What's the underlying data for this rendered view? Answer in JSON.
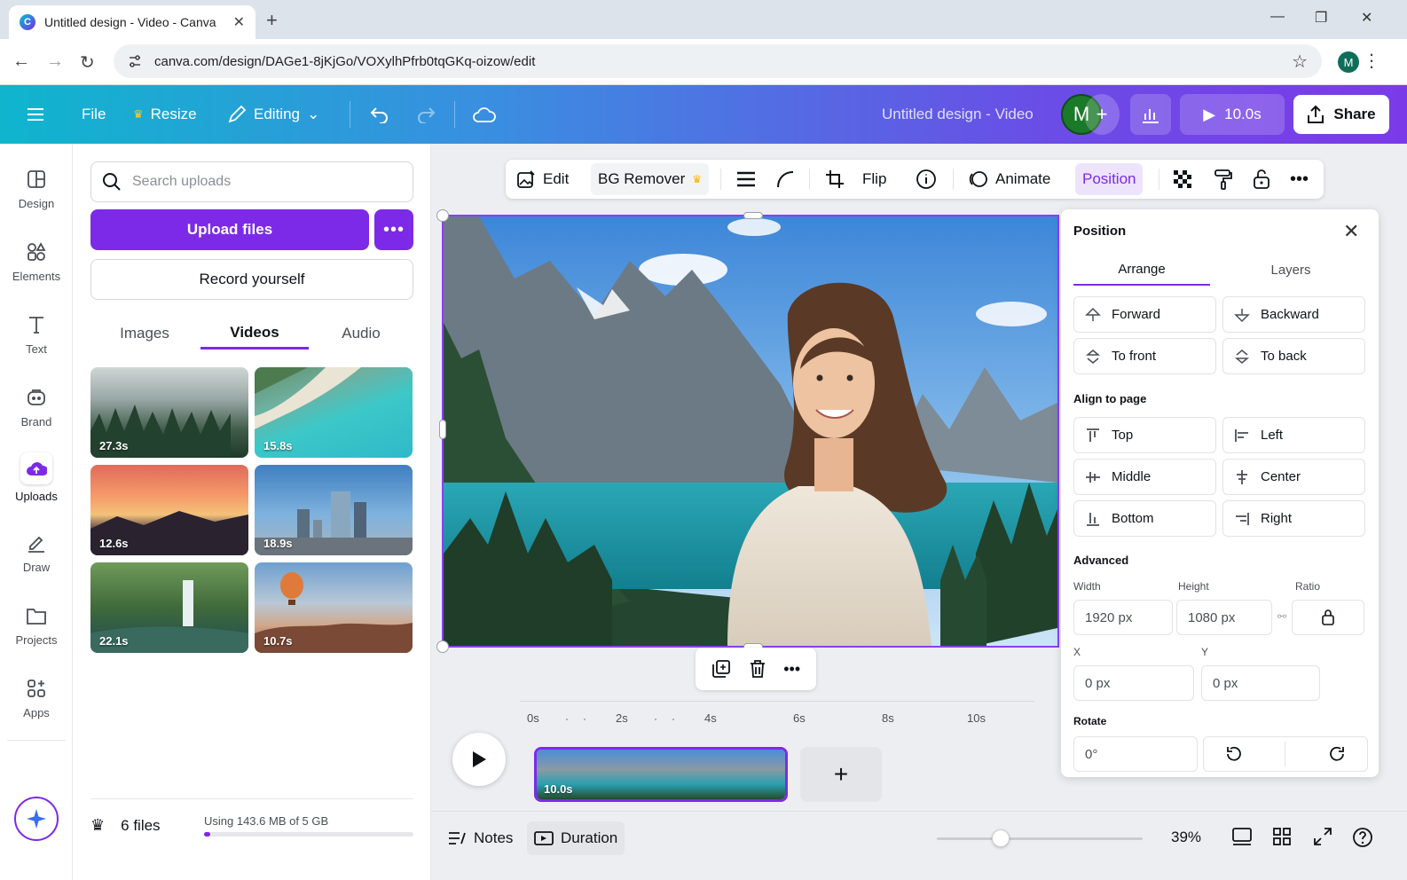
{
  "browser": {
    "tab_title": "Untitled design - Video - Canva",
    "url": "canva.com/design/DAGe1-8jKjGo/VOXylhPfrb0tqGKq-oizow/edit",
    "profile_initial": "M"
  },
  "header": {
    "file": "File",
    "resize": "Resize",
    "editing": "Editing",
    "doc_title": "Untitled design - Video",
    "avatar_initial": "M",
    "play_duration": "10.0s",
    "share": "Share"
  },
  "rail": {
    "items": [
      {
        "label": "Design",
        "icon": "design-icon"
      },
      {
        "label": "Elements",
        "icon": "elements-icon"
      },
      {
        "label": "Text",
        "icon": "text-icon"
      },
      {
        "label": "Brand",
        "icon": "brand-icon"
      },
      {
        "label": "Uploads",
        "icon": "cloud-upload-icon"
      },
      {
        "label": "Draw",
        "icon": "draw-icon"
      },
      {
        "label": "Projects",
        "icon": "folder-icon"
      },
      {
        "label": "Apps",
        "icon": "apps-icon"
      }
    ],
    "active": "Uploads"
  },
  "uploads": {
    "search_placeholder": "Search uploads",
    "upload_files": "Upload files",
    "record_yourself": "Record yourself",
    "tabs": [
      "Images",
      "Videos",
      "Audio"
    ],
    "active_tab": "Videos",
    "videos": [
      {
        "duration": "27.3s",
        "scene": "misty forest"
      },
      {
        "duration": "15.8s",
        "scene": "tropical beach"
      },
      {
        "duration": "12.6s",
        "scene": "sunset lake"
      },
      {
        "duration": "18.9s",
        "scene": "city skyline"
      },
      {
        "duration": "22.1s",
        "scene": "waterfall"
      },
      {
        "duration": "10.7s",
        "scene": "hot air balloon"
      }
    ],
    "files_count": "6 files",
    "storage_text": "Using 143.6 MB of 5 GB",
    "storage_used_fraction": 0.028
  },
  "toolbar": {
    "edit": "Edit",
    "bg_remover": "BG Remover",
    "flip": "Flip",
    "animate": "Animate",
    "position": "Position"
  },
  "position_panel": {
    "title": "Position",
    "tabs": [
      "Arrange",
      "Layers"
    ],
    "active_tab": "Arrange",
    "arrange": {
      "forward": "Forward",
      "backward": "Backward",
      "to_front": "To front",
      "to_back": "To back"
    },
    "align_heading": "Align to page",
    "align": {
      "top": "Top",
      "left": "Left",
      "middle": "Middle",
      "center": "Center",
      "bottom": "Bottom",
      "right": "Right"
    },
    "advanced_heading": "Advanced",
    "width_label": "Width",
    "height_label": "Height",
    "ratio_label": "Ratio",
    "width_value": "1920 px",
    "height_value": "1080 px",
    "x_label": "X",
    "y_label": "Y",
    "x_value": "0 px",
    "y_value": "0 px",
    "rotate_label": "Rotate",
    "rotate_value": "0°"
  },
  "timeline": {
    "ticks": [
      "0s",
      "2s",
      "4s",
      "6s",
      "8s",
      "10s"
    ],
    "clip_duration": "10.0s"
  },
  "footer": {
    "notes": "Notes",
    "duration": "Duration",
    "zoom": "39%",
    "zoom_fraction": 0.31
  },
  "colors": {
    "accent": "#7d2ae8",
    "header_gradient_start": "#0fb5cd",
    "header_gradient_end": "#7b3ae8"
  }
}
